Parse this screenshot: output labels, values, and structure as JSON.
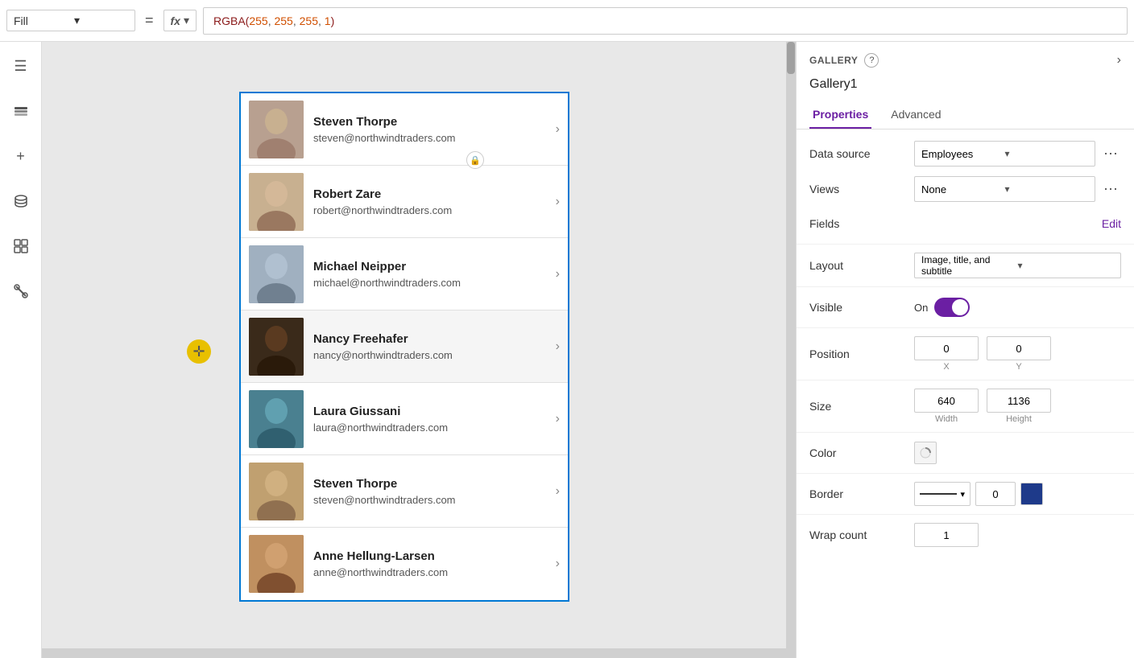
{
  "toolbar": {
    "fill_label": "Fill",
    "equals": "=",
    "fx_label": "fx",
    "fx_caret": "▾",
    "formula": "RGBA(255, 255, 255, 1)"
  },
  "sidebar": {
    "icons": [
      {
        "name": "menu-icon",
        "symbol": "☰"
      },
      {
        "name": "layers-icon",
        "symbol": "⊞"
      },
      {
        "name": "add-icon",
        "symbol": "+"
      },
      {
        "name": "database-icon",
        "symbol": "⬡"
      },
      {
        "name": "component-icon",
        "symbol": "⊟"
      },
      {
        "name": "tools-icon",
        "symbol": "⚒"
      }
    ]
  },
  "gallery": {
    "items": [
      {
        "name": "Steven Thorpe",
        "email": "steven@northwindtraders.com"
      },
      {
        "name": "Robert Zare",
        "email": "robert@northwindtraders.com"
      },
      {
        "name": "Michael Neipper",
        "email": "michael@northwindtraders.com"
      },
      {
        "name": "Nancy Freehafer",
        "email": "nancy@northwindtraders.com"
      },
      {
        "name": "Laura Giussani",
        "email": "laura@northwindtraders.com"
      },
      {
        "name": "Steven Thorpe",
        "email": "steven@northwindtraders.com"
      },
      {
        "name": "Anne Hellung-Larsen",
        "email": "anne@northwindtraders.com"
      }
    ],
    "avatarClasses": [
      "avatar-1",
      "avatar-2",
      "avatar-3",
      "avatar-4",
      "avatar-5",
      "avatar-6",
      "avatar-7"
    ]
  },
  "panel": {
    "section_title": "GALLERY",
    "help_symbol": "?",
    "expand_symbol": "›",
    "gallery_name": "Gallery1",
    "tab_properties": "Properties",
    "tab_advanced": "Advanced",
    "props": {
      "data_source_label": "Data source",
      "data_source_value": "Employees",
      "views_label": "Views",
      "views_value": "None",
      "fields_label": "Fields",
      "fields_edit": "Edit",
      "layout_label": "Layout",
      "layout_value": "Image, title, and subtitle",
      "visible_label": "Visible",
      "visible_toggle": "On",
      "position_label": "Position",
      "position_x": "0",
      "position_y": "0",
      "position_x_label": "X",
      "position_y_label": "Y",
      "size_label": "Size",
      "size_width": "640",
      "size_height": "1136",
      "size_width_label": "Width",
      "size_height_label": "Height",
      "color_label": "Color",
      "border_label": "Border",
      "border_thickness": "0",
      "wrap_count_label": "Wrap count",
      "wrap_count_value": "1"
    }
  }
}
